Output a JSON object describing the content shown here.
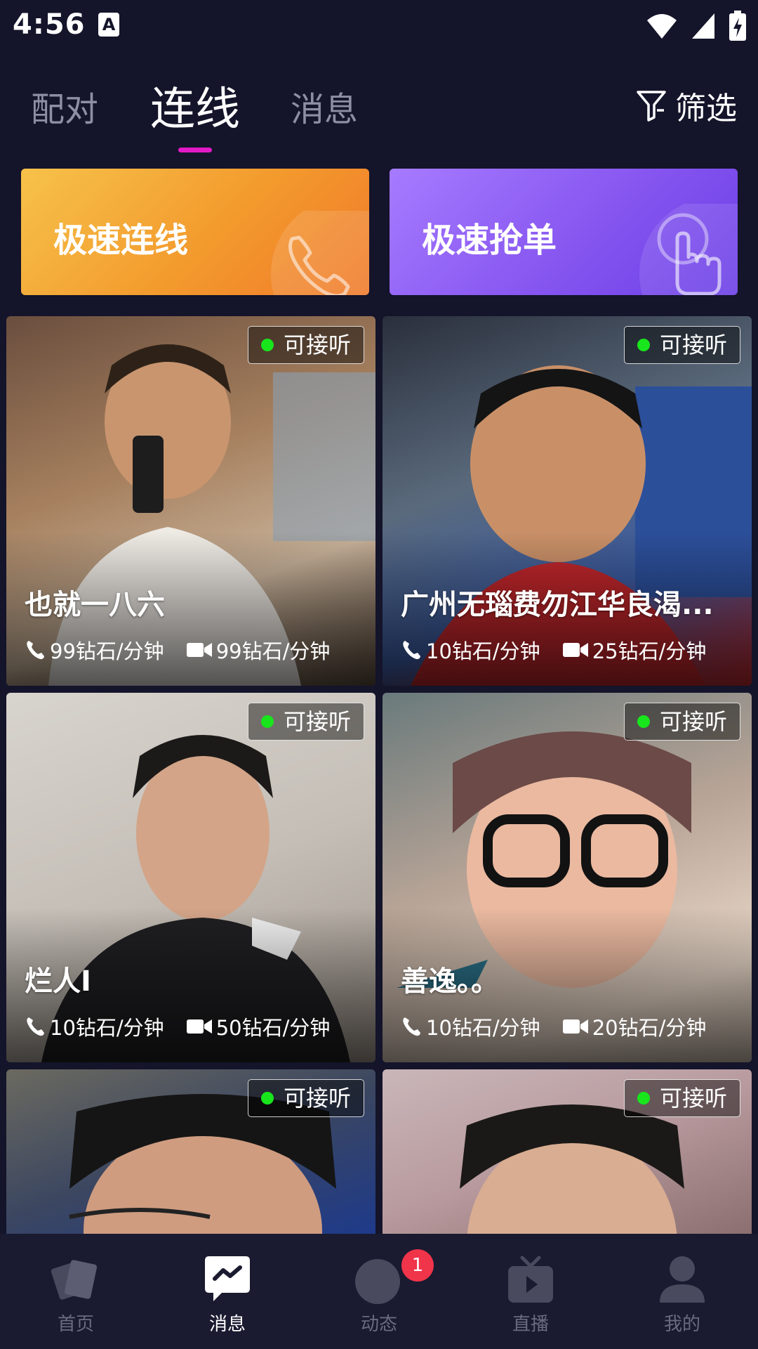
{
  "status_bar": {
    "time": "4:56",
    "app_icon": "A"
  },
  "tabs": [
    {
      "label": "配对",
      "active": false
    },
    {
      "label": "连线",
      "active": true
    },
    {
      "label": "消息",
      "active": false
    }
  ],
  "filter": {
    "label": "筛选",
    "icon": "filter-icon"
  },
  "banners": [
    {
      "label": "极速连线",
      "icon": "phone-icon"
    },
    {
      "label": "极速抢单",
      "icon": "hand-tap-icon"
    }
  ],
  "cards": [
    {
      "name": "也就一八六",
      "status": "可接听",
      "voice_price": "99钻石/分钟",
      "video_price": "99钻石/分钟"
    },
    {
      "name": "广州无瑙费勿江华良渴...",
      "status": "可接听",
      "voice_price": "10钻石/分钟",
      "video_price": "25钻石/分钟"
    },
    {
      "name": "烂人I",
      "status": "可接听",
      "voice_price": "10钻石/分钟",
      "video_price": "50钻石/分钟"
    },
    {
      "name": "善逸。。",
      "status": "可接听",
      "voice_price": "10钻石/分钟",
      "video_price": "20钻石/分钟"
    },
    {
      "name": "",
      "status": "可接听",
      "voice_price": "",
      "video_price": ""
    },
    {
      "name": "",
      "status": "可接听",
      "voice_price": "",
      "video_price": ""
    }
  ],
  "bottom_nav": [
    {
      "label": "首页",
      "icon": "cards-icon",
      "active": false
    },
    {
      "label": "消息",
      "icon": "chat-icon",
      "active": true
    },
    {
      "label": "动态",
      "icon": "moment-icon",
      "active": false,
      "badge": "1"
    },
    {
      "label": "直播",
      "icon": "tv-icon",
      "active": false
    },
    {
      "label": "我的",
      "icon": "profile-icon",
      "active": false
    }
  ],
  "colors": {
    "background": "#14142a",
    "tab_indicator": "#e21ac8",
    "online_dot": "#18e51c",
    "badge_red": "#f0344a",
    "orange_banner": "#f39a2d",
    "purple_banner": "#8756f0"
  }
}
